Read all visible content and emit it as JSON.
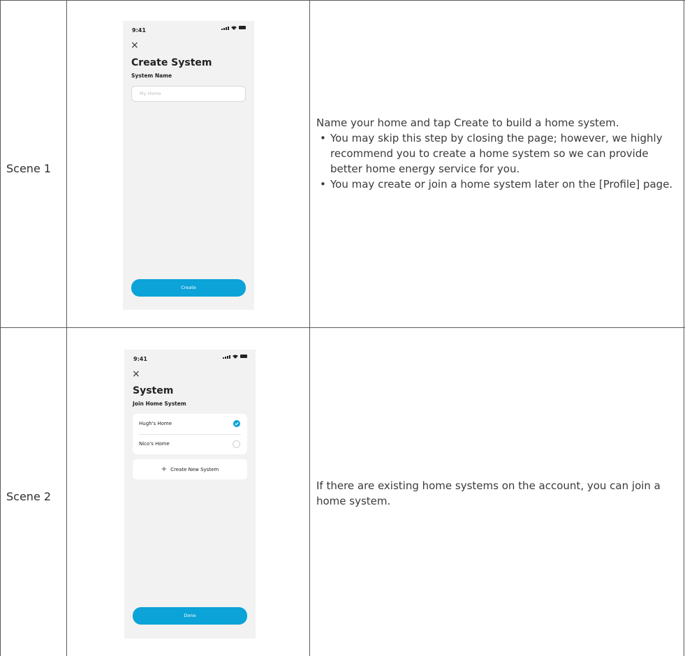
{
  "scenes": [
    {
      "label": "Scene 1",
      "phone": {
        "time": "9:41",
        "title": "Create System",
        "subtitle": "System Name",
        "input_placeholder": "My Home",
        "button_label": "Create"
      },
      "description": {
        "intro": "Name your home and tap Create to build a home system.",
        "bullets": [
          "You may skip this step by closing the page; however, we highly recommend you to create a home system so we can provide better home energy service for you.",
          "You may create or join a home system later on the [Profile] page."
        ]
      }
    },
    {
      "label": "Scene 2",
      "phone": {
        "time": "9:41",
        "title": "System",
        "subtitle": "Join Home System",
        "systems": [
          {
            "name": "Hugh's Home",
            "selected": true
          },
          {
            "name": "Nico's Home",
            "selected": false
          }
        ],
        "create_new_label": "Create New System",
        "button_label": "Done"
      },
      "description": {
        "intro": "If there are existing home systems on the account, you can join a home system."
      }
    }
  ],
  "colors": {
    "accent": "#0ba3d8",
    "phone_bg": "#f2f2f2",
    "grid": "#5a5a5a"
  },
  "icons": {
    "close": "close-icon",
    "check": "checkmark-icon",
    "plus": "plus-icon"
  }
}
